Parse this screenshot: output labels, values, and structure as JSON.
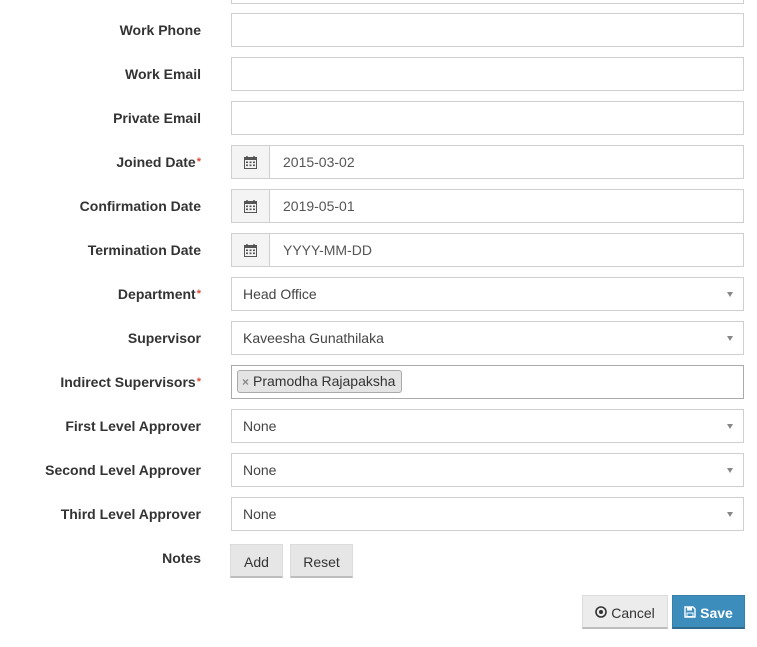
{
  "form": {
    "work_phone": {
      "label": "Work Phone",
      "value": ""
    },
    "work_email": {
      "label": "Work Email",
      "value": ""
    },
    "private_email": {
      "label": "Private Email",
      "value": ""
    },
    "joined_date": {
      "label": "Joined Date",
      "required_mark": "*",
      "value": "2015-03-02"
    },
    "confirmation_date": {
      "label": "Confirmation Date",
      "value": "2019-05-01"
    },
    "termination_date": {
      "label": "Termination Date",
      "value": "",
      "placeholder": "YYYY-MM-DD"
    },
    "department": {
      "label": "Department",
      "required_mark": "*",
      "value": "Head Office"
    },
    "supervisor": {
      "label": "Supervisor",
      "value": "Kaveesha Gunathilaka"
    },
    "indirect_supervisors": {
      "label": "Indirect Supervisors",
      "required_mark": "*",
      "tags": [
        "Pramodha Rajapaksha"
      ],
      "tag_remove": "×"
    },
    "first_level_approver": {
      "label": "First Level Approver",
      "value": "None"
    },
    "second_level_approver": {
      "label": "Second Level Approver",
      "value": "None"
    },
    "third_level_approver": {
      "label": "Third Level Approver",
      "value": "None"
    },
    "notes": {
      "label": "Notes",
      "add_label": "Add",
      "reset_label": "Reset"
    }
  },
  "actions": {
    "cancel_label": "Cancel",
    "save_label": "Save"
  },
  "icons": {
    "date": "calendar-icon",
    "cancel": "circle-x-icon",
    "save": "floppy-disk-icon",
    "select": "chevron-down-icon"
  },
  "colors": {
    "required": "#dd4b39",
    "primary": "#3c8dbc",
    "border": "#cfcfcf"
  }
}
